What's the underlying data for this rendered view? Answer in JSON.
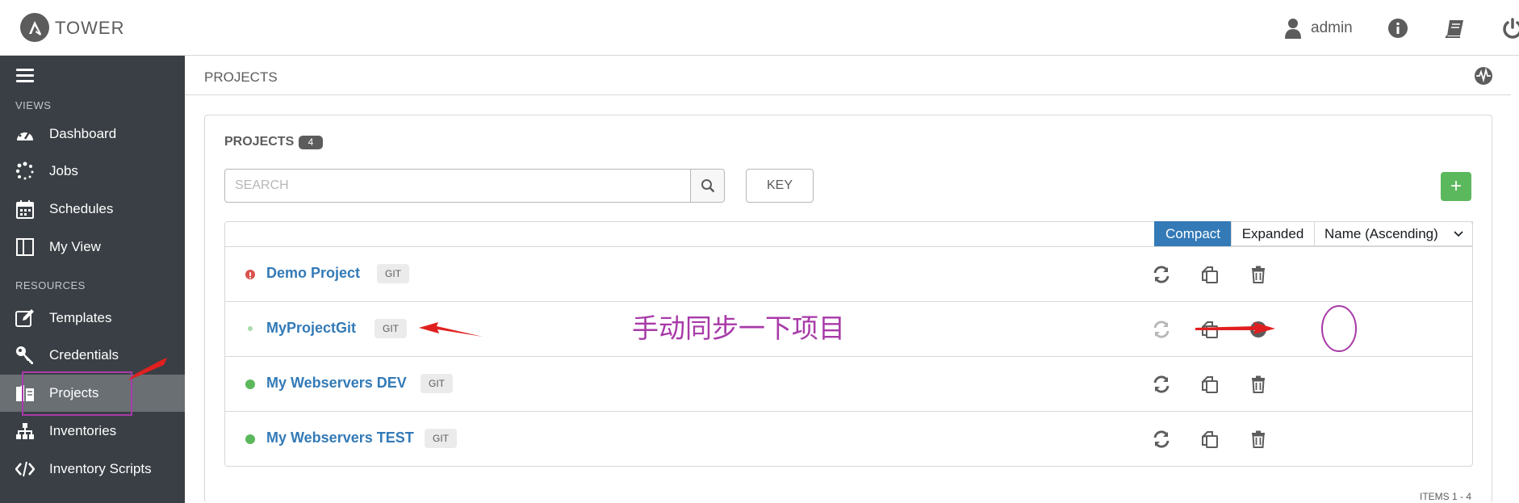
{
  "app": {
    "logo_text": "TOWER"
  },
  "topbar": {
    "user_name": "admin"
  },
  "sidebar": {
    "views_label": "VIEWS",
    "resources_label": "RESOURCES",
    "items": [
      {
        "label": "Dashboard",
        "icon": "dashboard-icon"
      },
      {
        "label": "Jobs",
        "icon": "jobs-spinner-icon"
      },
      {
        "label": "Schedules",
        "icon": "calendar-icon"
      },
      {
        "label": "My View",
        "icon": "columns-icon"
      },
      {
        "label": "Templates",
        "icon": "edit-icon"
      },
      {
        "label": "Credentials",
        "icon": "key-icon"
      },
      {
        "label": "Projects",
        "icon": "projects-icon"
      },
      {
        "label": "Inventories",
        "icon": "sitemap-icon"
      },
      {
        "label": "Inventory Scripts",
        "icon": "code-icon"
      }
    ]
  },
  "main": {
    "title": "PROJECTS"
  },
  "panel": {
    "title": "PROJECTS",
    "count": "4",
    "search_placeholder": "SEARCH",
    "key_label": "KEY",
    "add_label": "+",
    "view_compact": "Compact",
    "view_expanded": "Expanded",
    "sort_label": "Name (Ascending)",
    "items_label": "ITEMS  1 - 4"
  },
  "projects": [
    {
      "name": "Demo Project",
      "scm": "GIT",
      "status": "failed"
    },
    {
      "name": "MyProjectGit",
      "scm": "GIT",
      "status": "pending"
    },
    {
      "name": "My Webservers DEV",
      "scm": "GIT",
      "status": "successful"
    },
    {
      "name": "My Webservers TEST",
      "scm": "GIT",
      "status": "successful"
    }
  ],
  "annotation": {
    "text": "手动同步一下项目"
  },
  "colors": {
    "sidebar_bg": "#393f44",
    "sidebar_active": "#6a6f74",
    "link_blue": "#337ab7",
    "success_green": "#5cb85c",
    "failed_red": "#d9534f",
    "annotation_purple": "#a83aa8",
    "arrow_red": "#e02020"
  }
}
